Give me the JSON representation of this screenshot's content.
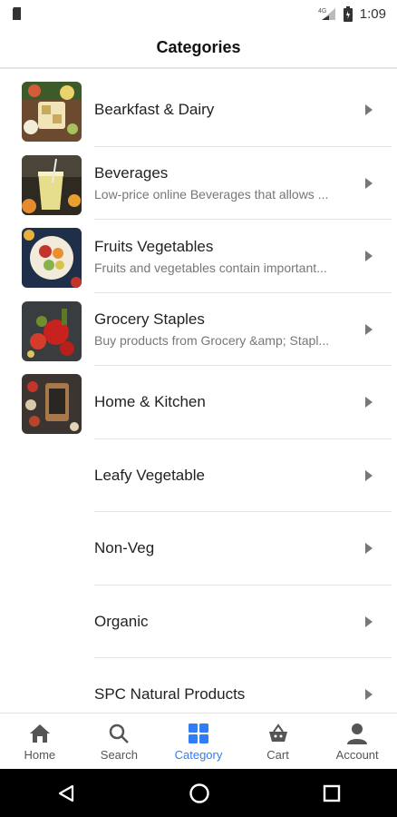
{
  "status_bar": {
    "time": "1:09",
    "network": "4G",
    "battery": "battery"
  },
  "header": {
    "title": "Categories"
  },
  "categories": [
    {
      "title": "Bearkfast & Dairy",
      "subtitle": "",
      "image": "breakfast-photo"
    },
    {
      "title": "Beverages",
      "subtitle": "Low-price online Beverages that allows ...",
      "image": "beverage-photo"
    },
    {
      "title": "Fruits Vegetables",
      "subtitle": "Fruits and vegetables contain important...",
      "image": "fruits-photo"
    },
    {
      "title": "Grocery Staples",
      "subtitle": "Buy products from Grocery &amp; Stapl...",
      "image": "grocery-photo"
    },
    {
      "title": "Home & Kitchen",
      "subtitle": "",
      "image": "kitchen-photo"
    },
    {
      "title": "Leafy Vegetable",
      "subtitle": ""
    },
    {
      "title": "Non-Veg",
      "subtitle": ""
    },
    {
      "title": "Organic",
      "subtitle": ""
    },
    {
      "title": "SPC Natural Products",
      "subtitle": ""
    }
  ],
  "bottom_nav": [
    {
      "label": "Home",
      "icon": "home-icon",
      "active": false
    },
    {
      "label": "Search",
      "icon": "search-icon",
      "active": false
    },
    {
      "label": "Category",
      "icon": "category-icon",
      "active": true
    },
    {
      "label": "Cart",
      "icon": "cart-icon",
      "active": false
    },
    {
      "label": "Account",
      "icon": "account-icon",
      "active": false
    }
  ],
  "colors": {
    "accent": "#2f7df6",
    "divider": "#e4e4e4",
    "nav_text": "#555555"
  }
}
